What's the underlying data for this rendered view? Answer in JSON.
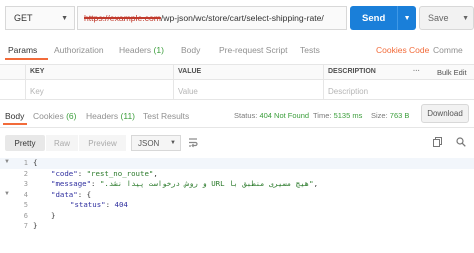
{
  "request": {
    "method": "GET",
    "url_redacted": "https://example.com",
    "url_path": "/wp-json/wc/store/cart/select-shipping-rate/",
    "send_label": "Send",
    "save_label": "Save"
  },
  "request_tabs": {
    "params": "Params",
    "authorization": "Authorization",
    "headers": "Headers",
    "headers_count": "(1)",
    "body": "Body",
    "prerequest": "Pre-request Script",
    "tests": "Tests",
    "cookies_link": "Cookies",
    "code_link": "Code",
    "comments_link": "Comme"
  },
  "params_table": {
    "headers": [
      "KEY",
      "VALUE",
      "DESCRIPTION"
    ],
    "more": "···",
    "bulk_edit": "Bulk Edit",
    "placeholders": [
      "Key",
      "Value",
      "Description"
    ]
  },
  "response_tabs": {
    "body": "Body",
    "cookies": "Cookies",
    "cookies_count": "(6)",
    "headers": "Headers",
    "headers_count": "(11)",
    "test_results": "Test Results"
  },
  "status": {
    "status_label": "Status:",
    "status_value": "404 Not Found",
    "time_label": "Time:",
    "time_value": "5135 ms",
    "size_label": "Size:",
    "size_value": "763 B",
    "download": "Download"
  },
  "body_toolbar": {
    "pretty": "Pretty",
    "raw": "Raw",
    "preview": "Preview",
    "format": "JSON"
  },
  "code_lines": {
    "numbers": [
      "1",
      "2",
      "3",
      "4",
      "5",
      "6",
      "7"
    ],
    "l1": "{",
    "l2_key": "\"code\"",
    "l2_val": "\"rest_no_route\"",
    "l3_key": "\"message\"",
    "l3_val": "\"هیچ مسیری منطبق با URL و روش درخواست پیدا نشد.\"",
    "l4_key": "\"data\"",
    "l4_val": "{",
    "l5_key": "\"status\"",
    "l5_val": "404",
    "l6": "}",
    "l7": "}"
  },
  "colors": {
    "send_blue": "#1a7fd9",
    "accent_orange": "#f26b3a",
    "status_green": "#3b9e3b"
  }
}
